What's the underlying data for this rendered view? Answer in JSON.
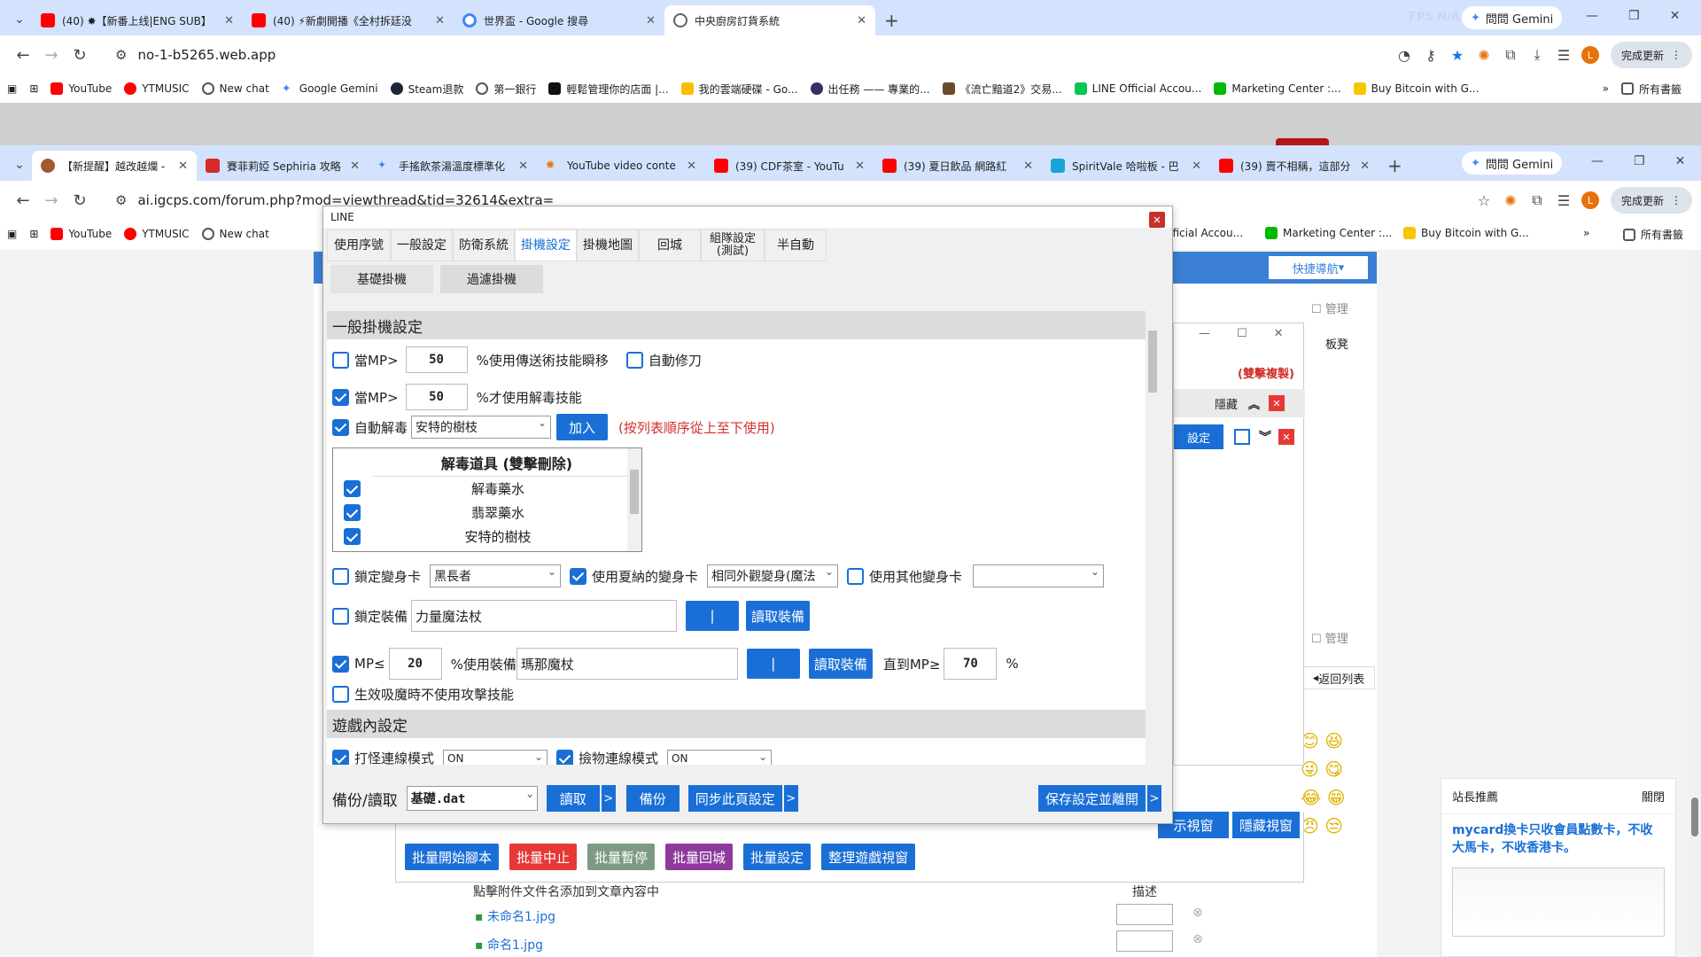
{
  "browser1": {
    "tabs": [
      {
        "title": "(40) ✸【新番上线|ENG SUB】",
        "favcolor": "#ff0000"
      },
      {
        "title": "(40) ⚡新劇開播《全村拆廷没",
        "favcolor": "#ff0000"
      },
      {
        "title": "世界盃 - Google 搜尋",
        "favcolor": "#4285f4"
      },
      {
        "title": "中央廚房訂貨系統",
        "favcolor": "#5f6368"
      }
    ],
    "url": "no-1-b5265.web.app",
    "gemini": "問問 Gemini",
    "update": "完成更新",
    "avatar": "L",
    "overlay_fps": "FPS N/A"
  },
  "bookmarks1": [
    "YouTube",
    "YTMUSIC",
    "New chat",
    "Google Gemini",
    "Steam退款",
    "第一銀行",
    "輕鬆管理你的店面 |...",
    "我的雲端硬碟 - Go...",
    "出任務 —— 專業的...",
    "《流亡黯道2》交易...",
    "LINE Official Accou...",
    "Marketing Center :...",
    "Buy Bitcoin with G..."
  ],
  "bookmarks_folder": "所有書籤",
  "browser2": {
    "tabs": [
      "【新提醒】越改越爛 -",
      "賽菲莉婭 Sephiria 攻略",
      "手搖飲茶湯溫度標準化",
      "YouTube video conte",
      "(39) CDF茶室 - YouTu",
      "(39) 夏日飲品 網路紅",
      "SpiritVale 哈啦板 - 巴",
      "(39) 賣不相稱，這部分"
    ],
    "url": "ai.igcps.com/forum.php?mod=viewthread&tid=32614&extra=",
    "gemini": "問問 Gemini",
    "update": "完成更新"
  },
  "bookmarks2": [
    "YouTube",
    "YTMUSIC",
    "New chat"
  ],
  "bookmarks2_right": [
    "Official Accou...",
    "Marketing Center :...",
    "Buy Bitcoin with G...",
    "所有書籤"
  ],
  "forum": {
    "quick_nav": "快捷導航",
    "manage": "管理",
    "stool": "板凳",
    "back_list": "返回列表",
    "attach_hint": "點擊附件文件名添加到文章內容中",
    "desc": "描述",
    "files": [
      "未命名1.jpg",
      "命名1.jpg"
    ],
    "recommend_title": "站長推薦",
    "close": "關閉",
    "recommend_text": "mycard換卡只收會員點數卡，不收大馬卡，不收香港卡。"
  },
  "tool_window": {
    "double_copy": "(雙擊複製)",
    "hide": "隱藏",
    "settings": "設定",
    "show_window": "示視窗",
    "hide_window": "隱藏視窗",
    "batch": [
      {
        "label": "批量開始腳本",
        "color": "#1a6fd6"
      },
      {
        "label": "批量中止",
        "color": "#e53935"
      },
      {
        "label": "批量暫停",
        "color": "#7d9a85"
      },
      {
        "label": "批量回城",
        "color": "#8e3a9d"
      },
      {
        "label": "批量設定",
        "color": "#1a6fd6"
      },
      {
        "label": "整理遊戲視窗",
        "color": "#1a6fd6"
      }
    ]
  },
  "dialog": {
    "title": "LINE",
    "tabs": [
      {
        "label": "使用序號"
      },
      {
        "label": "一般設定"
      },
      {
        "label": "防衛系統"
      },
      {
        "label": "掛機設定",
        "selected": true
      },
      {
        "label": "掛機地圖"
      },
      {
        "label": "回城"
      },
      {
        "label": "組隊設定\n(測試)"
      },
      {
        "label": "半自動"
      }
    ],
    "subtabs": [
      "基礎掛機",
      "過濾掛機"
    ],
    "section1": "一般掛機設定",
    "mp_teleport": {
      "checked": false,
      "pre": "當MP>",
      "value": "50",
      "post": "%使用傳送術技能瞬移"
    },
    "auto_repair": {
      "checked": false,
      "label": "自動修刀"
    },
    "mp_detox": {
      "checked": true,
      "pre": "當MP>",
      "value": "50",
      "post": "%才使用解毒技能"
    },
    "auto_detox": {
      "checked": true,
      "label": "自動解毒",
      "select": "安特的樹枝",
      "add": "加入",
      "hint": "(按列表順序從上至下使用)"
    },
    "detox_list": {
      "header": "解毒道具 (雙擊刪除)",
      "items": [
        "解毒藥水",
        "翡翠藥水",
        "安特的樹枝"
      ]
    },
    "lock_card": {
      "checked": false,
      "label": "鎖定變身卡",
      "select": "黑長者"
    },
    "summer_card": {
      "checked": true,
      "label": "使用夏納的變身卡",
      "select": "相同外觀變身(魔法"
    },
    "other_card": {
      "checked": false,
      "label": "使用其他變身卡",
      "select": ""
    },
    "lock_equip": {
      "checked": false,
      "label": "鎖定裝備",
      "value": "力量魔法杖",
      "pipe": "|",
      "read": "讀取裝備"
    },
    "mp_equip": {
      "checked": true,
      "pre": "MP≤",
      "value": "20",
      "mid": "%使用裝備",
      "equip": "瑪那魔杖",
      "pipe": "|",
      "read": "讀取裝備",
      "until": "直到MP≥",
      "until_value": "70",
      "pct": "%"
    },
    "no_attack": {
      "checked": false,
      "label": "生效吸魔時不使用攻擊技能"
    },
    "section2": "遊戲內設定",
    "mode1": {
      "checked": true,
      "label": "打怪連線模式",
      "select": "ON"
    },
    "mode2": {
      "checked": true,
      "label": "撿物連線模式",
      "select": "ON"
    },
    "footer": {
      "label": "備份/讀取",
      "file": "基礎.dat",
      "read": "讀取",
      "backup": "備份",
      "sync": "同步此頁設定",
      "save": "保存設定並離開",
      "arrow": ">"
    }
  }
}
